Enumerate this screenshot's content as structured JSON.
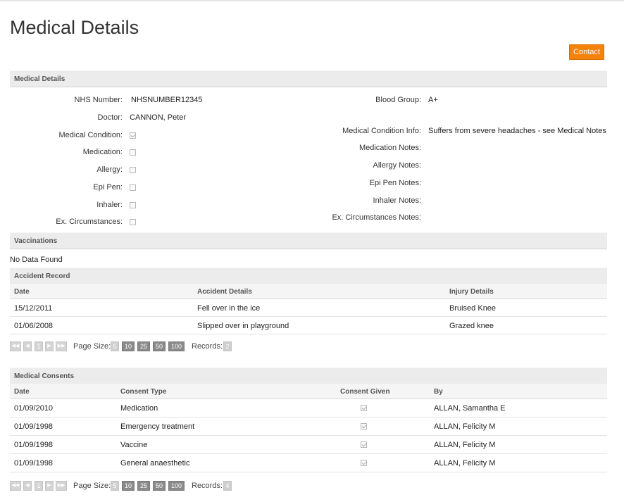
{
  "page": {
    "title": "Medical Details",
    "contact_label": "Contact"
  },
  "medical": {
    "header": "Medical Details",
    "left": [
      {
        "label": "NHS Number:",
        "value": "NHSNUMBER12345"
      },
      {
        "label": "Doctor:",
        "value": "CANNON, Peter"
      },
      {
        "label": "Medical Condition:",
        "checked": true
      },
      {
        "label": "Medication:",
        "checked": false
      },
      {
        "label": "Allergy:",
        "checked": false
      },
      {
        "label": "Epi Pen:",
        "checked": false
      },
      {
        "label": "Inhaler:",
        "checked": false
      },
      {
        "label": "Ex. Circumstances:",
        "checked": false
      }
    ],
    "right": [
      {
        "label": "Blood Group:",
        "value": "A+"
      },
      {
        "label": "Medical Condition Info:",
        "value": "Suffers from severe headaches - see Medical Notes"
      },
      {
        "label": "Medication Notes:",
        "value": ""
      },
      {
        "label": "Allergy Notes:",
        "value": ""
      },
      {
        "label": "Epi Pen Notes:",
        "value": ""
      },
      {
        "label": "Inhaler Notes:",
        "value": ""
      },
      {
        "label": "Ex. Circumstances Notes:",
        "value": ""
      }
    ]
  },
  "vaccinations": {
    "header": "Vaccinations",
    "empty_text": "No Data Found"
  },
  "accidents": {
    "header": "Accident Record",
    "columns": [
      "Date",
      "Accident Details",
      "Injury Details"
    ],
    "rows": [
      [
        "15/12/2011",
        "Fell over in the ice",
        "Bruised Knee"
      ],
      [
        "01/06/2008",
        "Slipped over in playground",
        "Grazed knee"
      ]
    ],
    "pager": {
      "page": "1",
      "page_size_label": "Page Size:",
      "sizes": [
        "5",
        "10",
        "25",
        "50",
        "100"
      ],
      "selected_size": "5",
      "records_label": "Records:",
      "records": "2"
    }
  },
  "consents": {
    "header": "Medical Consents",
    "columns": [
      "Date",
      "Consent Type",
      "Consent Given",
      "By"
    ],
    "rows": [
      {
        "date": "01/09/2010",
        "type": "Medication",
        "given": true,
        "by": "ALLAN, Samantha E"
      },
      {
        "date": "01/09/1998",
        "type": "Emergency treatment",
        "given": true,
        "by": "ALLAN, Felicity M"
      },
      {
        "date": "01/09/1998",
        "type": "Vaccine",
        "given": true,
        "by": "ALLAN, Felicity M"
      },
      {
        "date": "01/09/1998",
        "type": "General anaesthetic",
        "given": true,
        "by": "ALLAN, Felicity M"
      }
    ],
    "pager": {
      "page": "1",
      "page_size_label": "Page Size:",
      "sizes": [
        "5",
        "10",
        "25",
        "50",
        "100"
      ],
      "selected_size": "5",
      "records_label": "Records:",
      "records": "4"
    }
  }
}
